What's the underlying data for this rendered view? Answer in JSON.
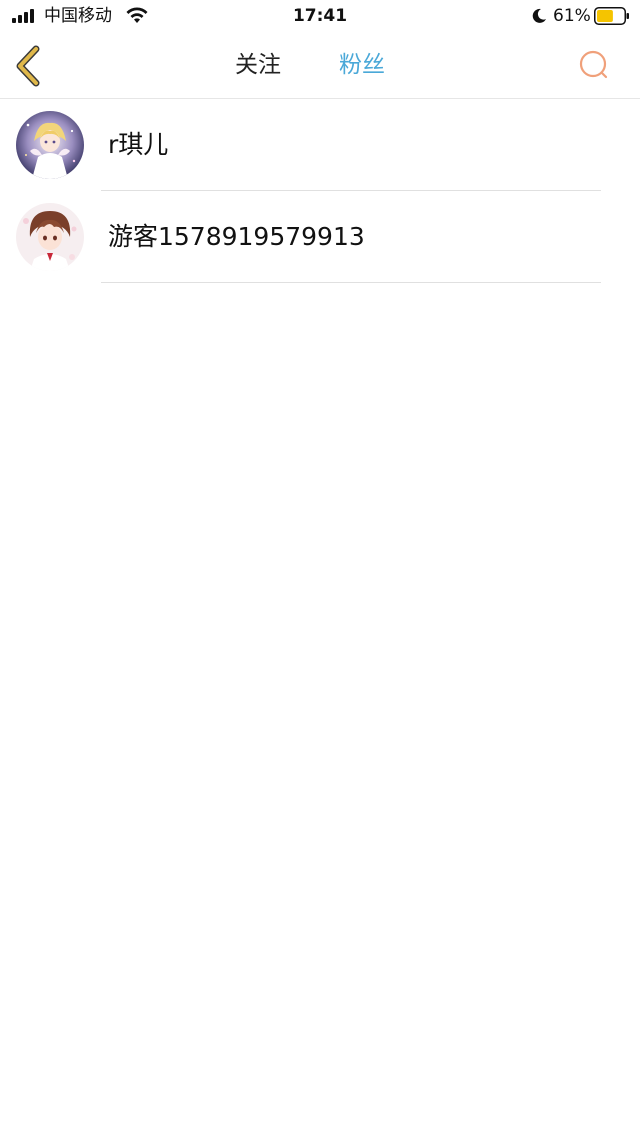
{
  "status_bar": {
    "carrier": "中国移动",
    "time": "17:41",
    "battery_percent": "61%",
    "battery_level": 0.61,
    "icons": [
      "signal-icon",
      "wifi-icon",
      "moon-icon",
      "battery-icon"
    ],
    "battery_color": "#f5c400"
  },
  "nav": {
    "back_icon": "chevron-left-icon",
    "tabs": [
      {
        "label": "关注",
        "active": false
      },
      {
        "label": "粉丝",
        "active": true
      }
    ],
    "search_icon": "search-icon",
    "accent_color": "#4aa8d8",
    "back_icon_color": "#e0b84a",
    "search_icon_color": "#f0a07a"
  },
  "fans": [
    {
      "name": "r琪儿",
      "avatar": "avatar-anime-girl"
    },
    {
      "name": "游客1578919579913",
      "avatar": "avatar-anime-boy"
    }
  ]
}
